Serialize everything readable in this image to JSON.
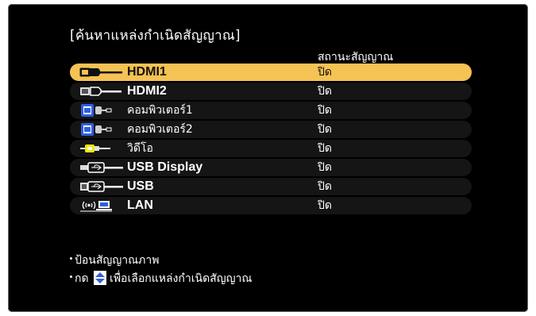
{
  "title": "[ค้นหาแหล่งกำเนิดสัญญาณ]",
  "status_header": "สถานะสัญญาณ",
  "sources": [
    {
      "label": "HDMI1",
      "status": "ปิด",
      "icon": "hdmi-icon",
      "selected": true
    },
    {
      "label": "HDMI2",
      "status": "ปิด",
      "icon": "hdmi-icon",
      "selected": false
    },
    {
      "label": "คอมพิวเตอร์1",
      "status": "ปิด",
      "icon": "computer-vga-icon",
      "selected": false
    },
    {
      "label": "คอมพิวเตอร์2",
      "status": "ปิด",
      "icon": "computer-vga-icon",
      "selected": false
    },
    {
      "label": "วิดีโอ",
      "status": "ปิด",
      "icon": "video-rca-icon",
      "selected": false
    },
    {
      "label": "USB Display",
      "status": "ปิด",
      "icon": "usb-display-icon",
      "selected": false
    },
    {
      "label": "USB",
      "status": "ปิด",
      "icon": "usb-icon",
      "selected": false
    },
    {
      "label": "LAN",
      "status": "ปิด",
      "icon": "lan-wireless-icon",
      "selected": false
    }
  ],
  "footer": {
    "line1": "ป้อนสัญญาณภาพ",
    "line2_prefix": "กด",
    "line2_suffix": "เพื่อเลือกแหล่งกำเนิดสัญญาณ"
  },
  "colors": {
    "selected_row": "#f5c254",
    "row": "#151515",
    "background": "#000000",
    "icon_blue": "#2f5fe0",
    "icon_yellow": "#f2e600"
  }
}
